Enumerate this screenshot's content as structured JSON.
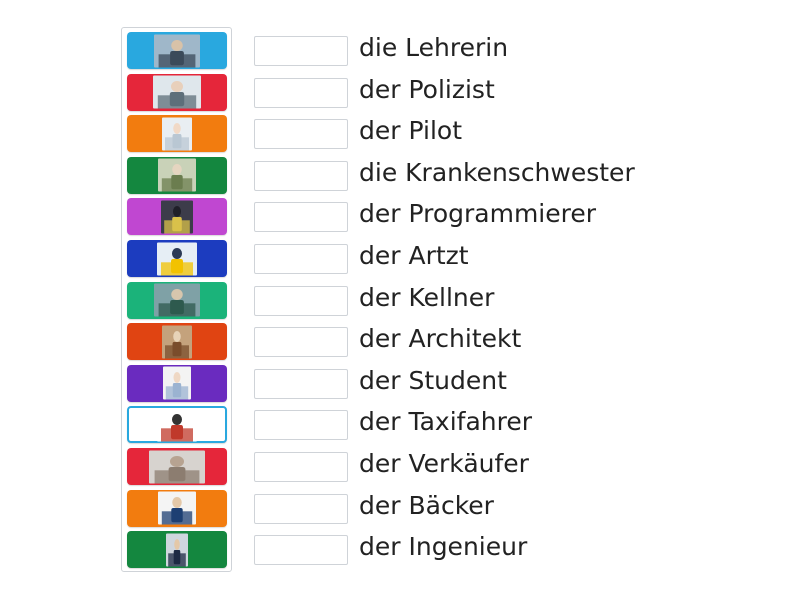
{
  "tiles": [
    {
      "color": "#29a8df",
      "image": "teacher-in-cockpit-photo-icon"
    },
    {
      "color": "#e5263a",
      "image": "man-at-car-photo-icon"
    },
    {
      "color": "#f27c0f",
      "image": "doctor-photo-icon"
    },
    {
      "color": "#14873f",
      "image": "baker-at-counter-photo-icon"
    },
    {
      "color": "#c047d1",
      "image": "programmer-at-desk-photo-icon"
    },
    {
      "color": "#1c3cbf",
      "image": "engineers-with-helmets-photo-icon"
    },
    {
      "color": "#1bb37a",
      "image": "classroom-teacher-photo-icon"
    },
    {
      "color": "#e04412",
      "image": "bakery-shelf-photo-icon"
    },
    {
      "color": "#6a2bbf",
      "image": "nurse-photo-icon"
    },
    {
      "color": "#ffffff",
      "image": "waiter-running-photo-icon"
    },
    {
      "color": "#e5263a",
      "image": "shop-assistant-photo-icon"
    },
    {
      "color": "#f27c0f",
      "image": "student-with-laptop-photo-icon"
    },
    {
      "color": "#14873f",
      "image": "police-officer-photo-icon"
    }
  ],
  "words": [
    "die Lehrerin",
    "der Polizist",
    "der Pilot",
    "die Krankenschwester",
    "der Programmierer",
    "der Artzt",
    "der Kellner",
    "der Architekt",
    "der Student",
    "der Taxifahrer",
    "der Verkäufer",
    "der Bäcker",
    "der Ingenieur"
  ]
}
